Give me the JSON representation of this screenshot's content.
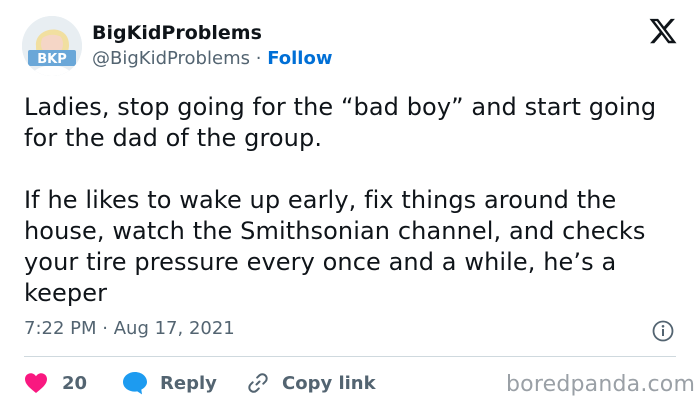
{
  "header": {
    "display_name": "BigKidProblems",
    "handle": "@BigKidProblems",
    "separator": "·",
    "follow_label": "Follow",
    "avatar_text": "BKP"
  },
  "tweet": {
    "paragraph_1": "Ladies, stop going for the “bad boy” and start going for the dad of the group.",
    "paragraph_2": "If he likes to wake up early, fix things around the house, watch the Smithsonian channel, and checks your tire pressure every once and a while, he’s a keeper"
  },
  "meta": {
    "time": "7:22 PM",
    "separator": "·",
    "date": "Aug 17, 2021"
  },
  "actions": {
    "like_count": "20",
    "reply_label": "Reply",
    "copy_link_label": "Copy link"
  },
  "watermark": "boredpanda.com",
  "colors": {
    "accent": "#006fd6",
    "like": "#f91880",
    "reply": "#1d9bf0",
    "muted": "#536471"
  },
  "icons": [
    "x-logo-icon",
    "info-icon",
    "heart-icon",
    "reply-bubble-icon",
    "link-icon"
  ]
}
